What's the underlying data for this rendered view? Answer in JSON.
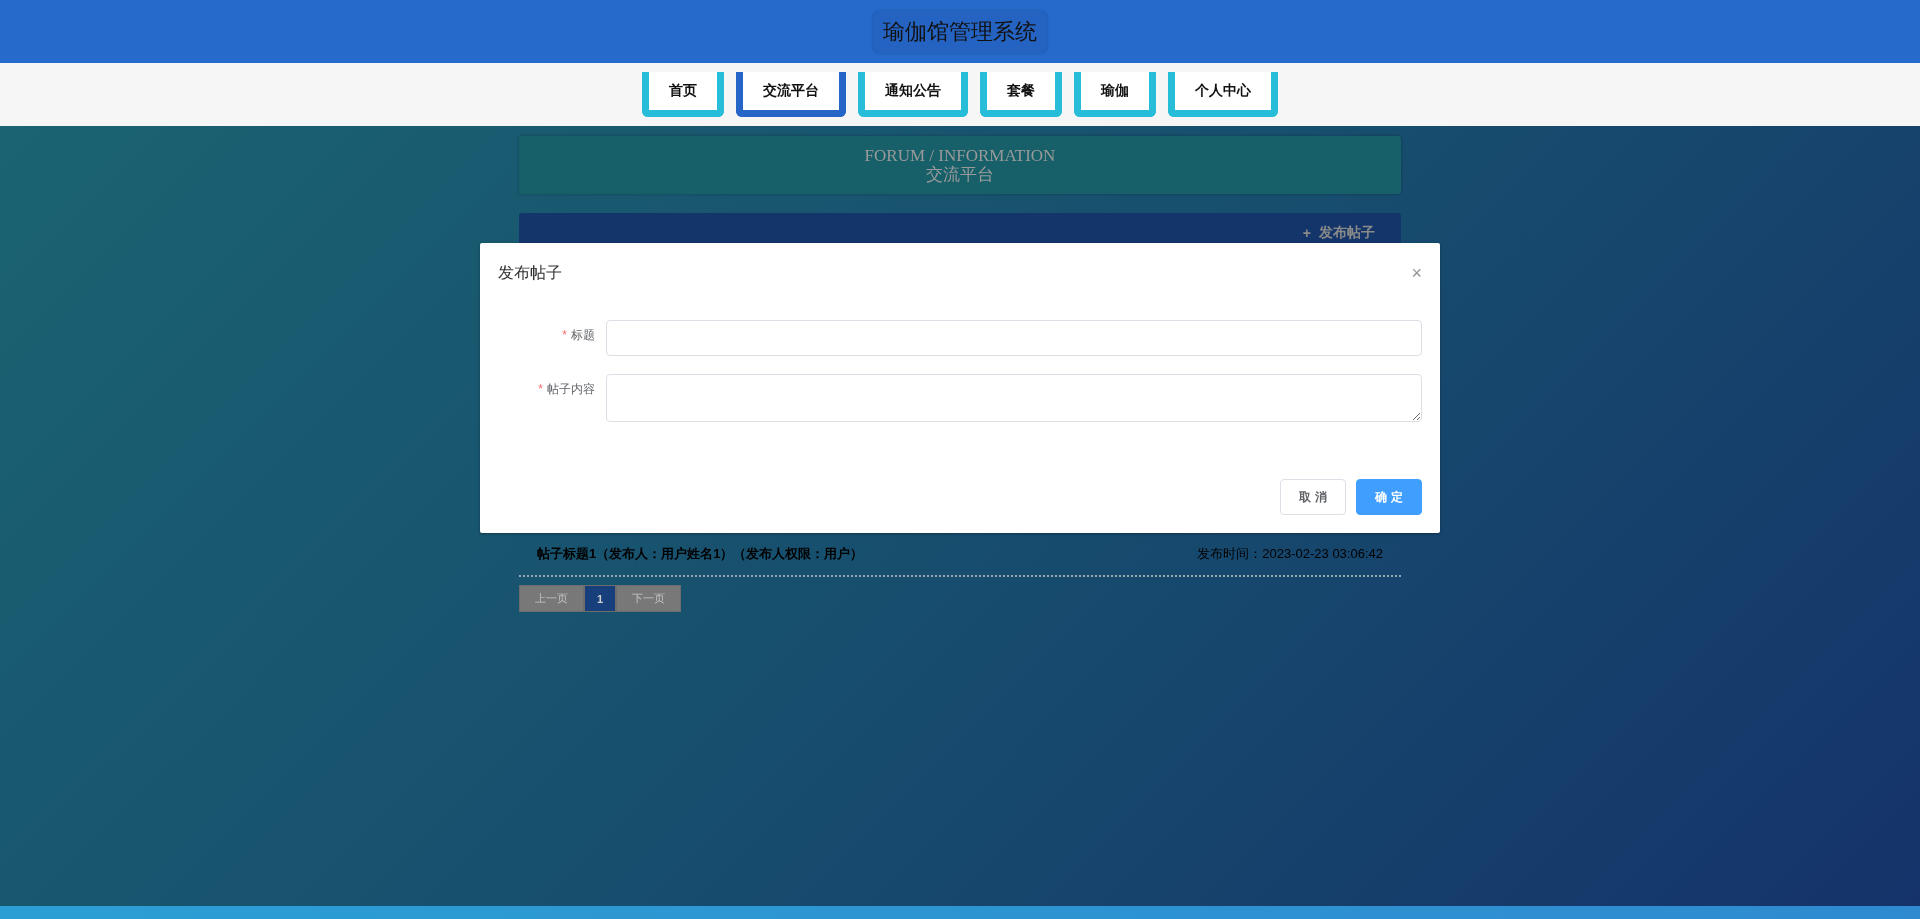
{
  "header": {
    "title": "瑜伽馆管理系统"
  },
  "nav": [
    {
      "label": "首页",
      "selected": false
    },
    {
      "label": "交流平台",
      "selected": true
    },
    {
      "label": "通知公告",
      "selected": false
    },
    {
      "label": "套餐",
      "selected": false
    },
    {
      "label": "瑜伽",
      "selected": false
    },
    {
      "label": "个人中心",
      "selected": false
    }
  ],
  "banner": {
    "subtitle": "FORUM / INFORMATION",
    "title": "交流平台"
  },
  "add_button": {
    "icon": "+",
    "label": "发布帖子"
  },
  "posts": [
    {
      "title": "帖子标题1（发布人：用户姓名1）（发布人权限：用户）",
      "time": "发布时间：2023-02-23 03:06:42"
    }
  ],
  "pagination": {
    "prev": "上一页",
    "pages": [
      {
        "label": "1",
        "selected": true
      }
    ],
    "next": "下一页"
  },
  "dialog": {
    "title": "发布帖子",
    "close": "×",
    "required_mark": "*",
    "fields": [
      {
        "label": "标题",
        "required": true,
        "kind": "input"
      },
      {
        "label": "帖子内容",
        "required": true,
        "kind": "textarea"
      }
    ],
    "buttons": [
      {
        "label": "取 消",
        "kind": "default"
      },
      {
        "label": "确 定",
        "kind": "primary"
      }
    ]
  }
}
